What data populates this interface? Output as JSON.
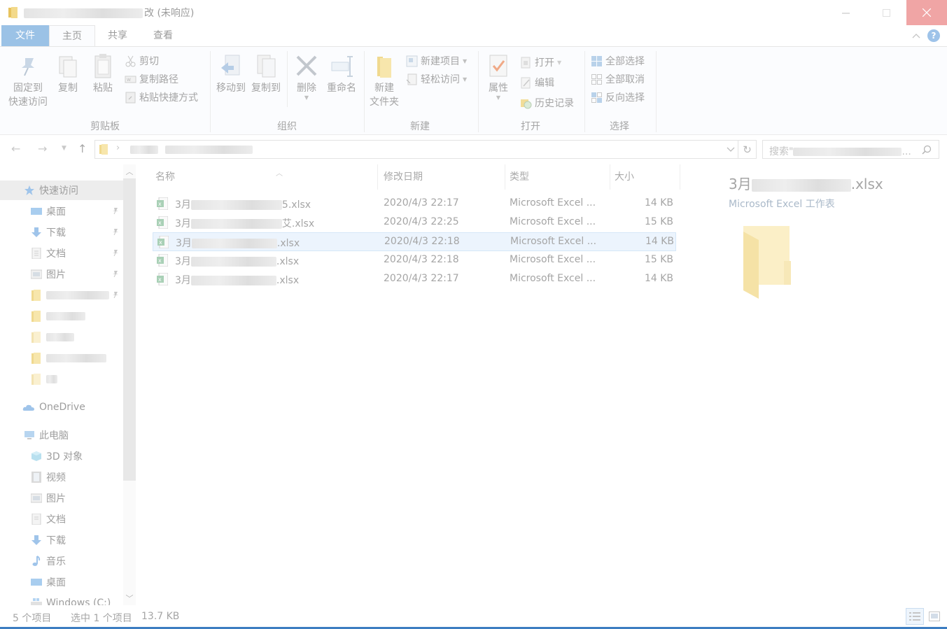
{
  "window": {
    "title_suffix": "改 (未响应)",
    "colors": {
      "accent": "#9bc2e6",
      "close_hover": "#f0a5a5",
      "selection": "#ecf4fd"
    }
  },
  "tabs": {
    "file": "文件",
    "home": "主页",
    "share": "共享",
    "view": "查看"
  },
  "ribbon": {
    "clipboard": {
      "label": "剪贴板",
      "pin_line1": "固定到",
      "pin_line2": "快速访问",
      "copy": "复制",
      "paste": "粘贴",
      "cut": "剪切",
      "copy_path": "复制路径",
      "paste_shortcut": "粘贴快捷方式"
    },
    "organize": {
      "label": "组织",
      "move_to": "移动到",
      "copy_to": "复制到",
      "delete": "删除",
      "rename": "重命名"
    },
    "new": {
      "label": "新建",
      "new_folder_line1": "新建",
      "new_folder_line2": "文件夹",
      "new_item": "新建项目",
      "easy_access": "轻松访问"
    },
    "open": {
      "label": "打开",
      "properties": "属性",
      "open": "打开",
      "edit": "编辑",
      "history": "历史记录"
    },
    "select": {
      "label": "选择",
      "select_all": "全部选择",
      "select_none": "全部取消",
      "invert": "反向选择"
    }
  },
  "search": {
    "prefix": "搜索\"",
    "suffix": "..."
  },
  "nav": {
    "quick_access": "快速访问",
    "pinned": [
      "桌面",
      "下载",
      "文档",
      "图片"
    ],
    "onedrive": "OneDrive",
    "this_pc": "此电脑",
    "pc_items": [
      "3D 对象",
      "视频",
      "图片",
      "文档",
      "下载",
      "音乐",
      "桌面",
      "Windows (C:)"
    ]
  },
  "columns": {
    "name": "名称",
    "date": "修改日期",
    "type": "类型",
    "size": "大小"
  },
  "files": [
    {
      "prefix": "3月",
      "ext": "5.xlsx",
      "date": "2020/4/3 22:17",
      "type": "Microsoft Excel ...",
      "size": "14 KB"
    },
    {
      "prefix": "3月",
      "ext": "艾.xlsx",
      "date": "2020/4/3 22:25",
      "type": "Microsoft Excel ...",
      "size": "15 KB"
    },
    {
      "prefix": "3月",
      "ext": ".xlsx",
      "date": "2020/4/3 22:18",
      "type": "Microsoft Excel ...",
      "size": "14 KB"
    },
    {
      "prefix": "3月",
      "ext": ".xlsx",
      "date": "2020/4/3 22:18",
      "type": "Microsoft Excel ...",
      "size": "15 KB"
    },
    {
      "prefix": "3月",
      "ext": ".xlsx",
      "date": "2020/4/3 22:17",
      "type": "Microsoft Excel ...",
      "size": "14 KB"
    }
  ],
  "preview": {
    "title_prefix": "3月",
    "title_ext": ".xlsx",
    "type": "Microsoft Excel 工作表"
  },
  "status": {
    "count": "5 个项目",
    "selected": "选中 1 个项目",
    "size": "13.7 KB"
  }
}
